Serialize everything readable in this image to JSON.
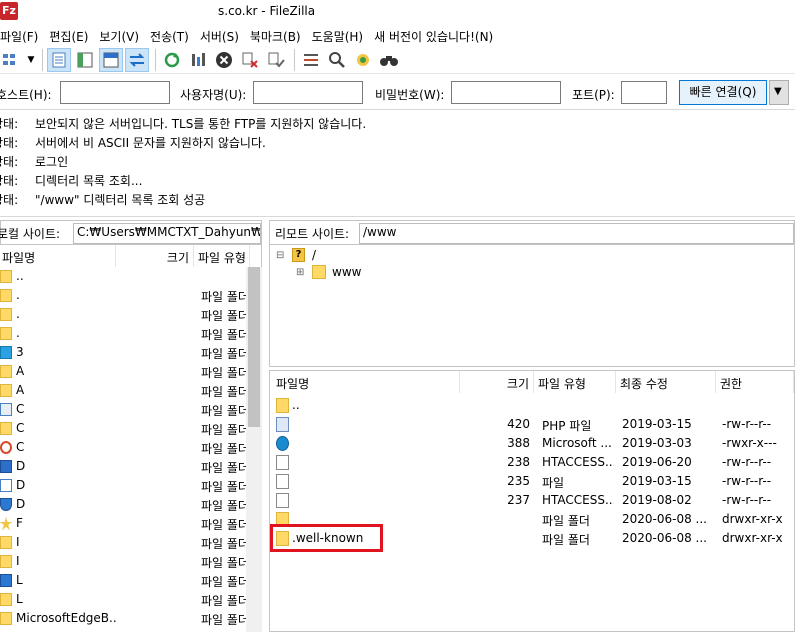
{
  "window": {
    "title": "s.co.kr - FileZilla",
    "app_icon": "Fz"
  },
  "menu": [
    "파일(F)",
    "편집(E)",
    "보기(V)",
    "전송(T)",
    "서버(S)",
    "북마크(B)",
    "도움말(H)",
    "새 버전이 있습니다!(N)"
  ],
  "quickconnect": {
    "host_label": "호스트(H):",
    "user_label": "사용자명(U):",
    "pass_label": "비밀번호(W):",
    "port_label": "포트(P):",
    "host_value": "",
    "user_value": "",
    "pass_value": "",
    "port_value": "",
    "connect_label": "빠른 연결(Q)"
  },
  "log": [
    {
      "label": "상태:",
      "message": "보안되지 않은 서버입니다. TLS를 통한 FTP를 지원하지 않습니다."
    },
    {
      "label": "상태:",
      "message": "서버에서 비 ASCII 문자를 지원하지 않습니다."
    },
    {
      "label": "상태:",
      "message": "로그인"
    },
    {
      "label": "상태:",
      "message": "디렉터리 목록 조회..."
    },
    {
      "label": "상태:",
      "message": "\"/www\" 디렉터리 목록 조회 성공"
    }
  ],
  "local": {
    "site_label": "로컬 사이트:",
    "path": "C:₩Users₩MMCTXT_Dahyun₩",
    "columns": {
      "name": "파일명",
      "size": "크기",
      "type": "파일 유형"
    },
    "rows": [
      {
        "name": "..",
        "type": "",
        "icon": "folder"
      },
      {
        "name": ".",
        "type": "파일 폴더",
        "icon": "folder"
      },
      {
        "name": ".",
        "type": "파일 폴더",
        "icon": "folder"
      },
      {
        "name": ".",
        "type": "파일 폴더",
        "icon": "folder"
      },
      {
        "name": "3",
        "type": "파일 폴더",
        "icon": "cube"
      },
      {
        "name": "A",
        "type": "파일 폴더",
        "icon": "folder"
      },
      {
        "name": "A",
        "type": "파일 폴더",
        "icon": "folder"
      },
      {
        "name": "C",
        "type": "파일 폴더",
        "icon": "contacts"
      },
      {
        "name": "C",
        "type": "파일 폴더",
        "icon": "folder"
      },
      {
        "name": "C",
        "type": "파일 폴더",
        "icon": "link"
      },
      {
        "name": "D",
        "type": "파일 폴더",
        "icon": "desktop"
      },
      {
        "name": "D",
        "type": "파일 폴더",
        "icon": "document"
      },
      {
        "name": "D",
        "type": "파일 폴더",
        "icon": "download"
      },
      {
        "name": "F",
        "type": "파일 폴더",
        "icon": "star"
      },
      {
        "name": "I",
        "type": "파일 폴더",
        "icon": "folder"
      },
      {
        "name": "I",
        "type": "파일 폴더",
        "icon": "folder"
      },
      {
        "name": "L",
        "type": "파일 폴더",
        "icon": "shortcut"
      },
      {
        "name": "L",
        "type": "파일 폴더",
        "icon": "folder"
      },
      {
        "name": "MicrosoftEdgeB...",
        "type": "파일 폴더",
        "icon": "folder"
      }
    ]
  },
  "remote": {
    "site_label": "리모트 사이트:",
    "path": "/www",
    "tree": {
      "root": "/",
      "child": "www"
    },
    "columns": {
      "name": "파일명",
      "size": "크기",
      "type": "파일 유형",
      "modified": "최종 수정",
      "perms": "권한"
    },
    "rows": [
      {
        "name": "..",
        "size": "",
        "type": "",
        "modified": "",
        "perms": "",
        "icon": "folder"
      },
      {
        "name": "",
        "size": "420",
        "type": "PHP 파일",
        "modified": "2019-03-15",
        "perms": "-rw-r--r--",
        "icon": "php"
      },
      {
        "name": "",
        "size": "388",
        "type": "Microsoft ...",
        "modified": "2019-03-03",
        "perms": "-rwxr-x---",
        "icon": "edge"
      },
      {
        "name": "",
        "size": "238",
        "type": "HTACCESS...",
        "modified": "2019-06-20",
        "perms": "-rw-r--r--",
        "icon": "file"
      },
      {
        "name": "",
        "size": "235",
        "type": "파일",
        "modified": "2019-03-15",
        "perms": "-rw-r--r--",
        "icon": "file"
      },
      {
        "name": "",
        "size": "237",
        "type": "HTACCESS...",
        "modified": "2019-08-02",
        "perms": "-rw-r--r--",
        "icon": "file"
      },
      {
        "name": "",
        "size": "",
        "type": "파일 폴더",
        "modified": "2020-06-08 ...",
        "perms": "drwxr-xr-x",
        "icon": "folder"
      },
      {
        "name": ".well-known",
        "size": "",
        "type": "파일 폴더",
        "modified": "2020-06-08 ...",
        "perms": "drwxr-xr-x",
        "icon": "folder"
      }
    ]
  },
  "colors": {
    "highlight": "#e0141e",
    "folder": "#ffd966",
    "accent": "#0078d7"
  }
}
